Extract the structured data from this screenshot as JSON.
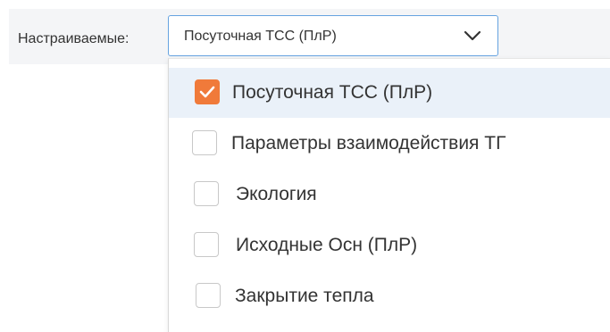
{
  "filter": {
    "label": "Настраиваемые:",
    "selected_value": "Посуточная ТСС (ПлР)"
  },
  "dropdown": {
    "options": [
      {
        "label": "Посуточная ТСС (ПлР)",
        "checked": true
      },
      {
        "label": "Параметры взаимодействия ТГ",
        "checked": false
      },
      {
        "label": "Экология",
        "checked": false
      },
      {
        "label": "Исходные Осн (ПлР)",
        "checked": false
      },
      {
        "label": "Закрытие тепла",
        "checked": false
      }
    ]
  },
  "colors": {
    "accent": "#f07a3a",
    "focus_border": "#66a3e0",
    "selected_row": "#eaf1f9"
  },
  "icons": {
    "chevron": "chevron-down-icon",
    "check": "checkmark-icon"
  }
}
